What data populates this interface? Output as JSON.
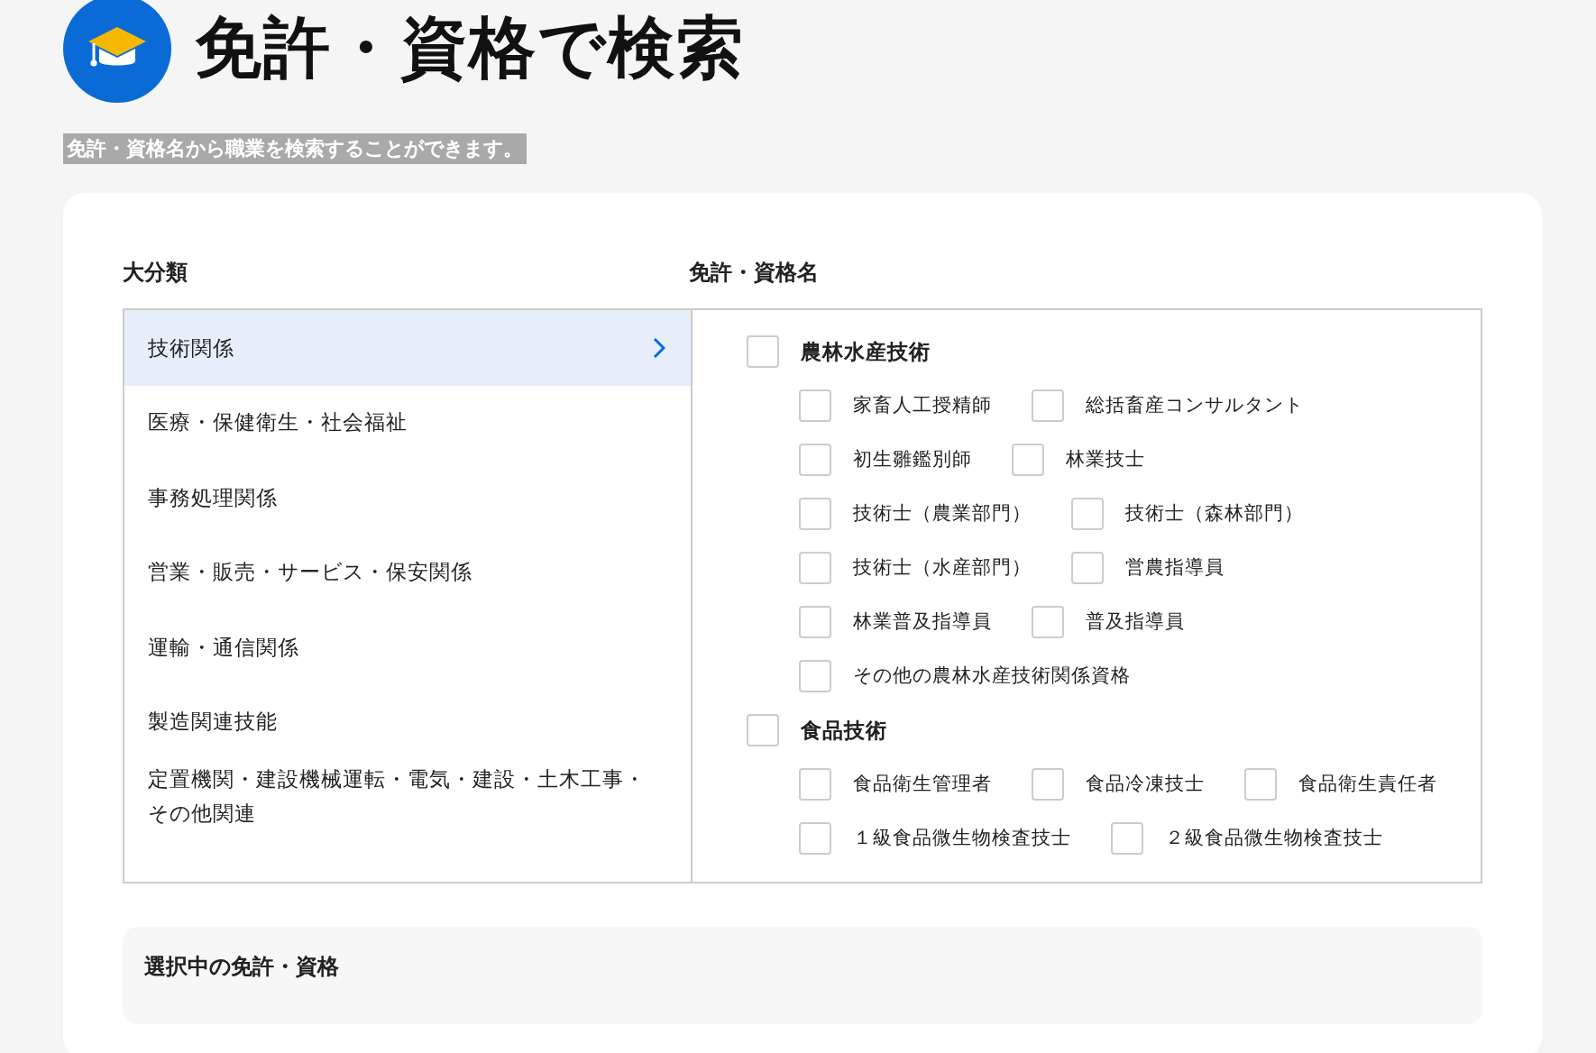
{
  "page": {
    "title": "免許・資格で検索",
    "description": "免許・資格名から職業を検索することができます。"
  },
  "search": {
    "category_heading": "大分類",
    "license_heading": "免許・資格名",
    "categories": [
      {
        "label": "技術関係",
        "selected": true
      },
      {
        "label": "医療・保健衛生・社会福祉",
        "selected": false
      },
      {
        "label": "事務処理関係",
        "selected": false
      },
      {
        "label": "営業・販売・サービス・保安関係",
        "selected": false
      },
      {
        "label": "運輸・通信関係",
        "selected": false
      },
      {
        "label": "製造関連技能",
        "selected": false
      },
      {
        "label": "定置機関・建設機械運転・電気・建設・土木工事・その他関連",
        "selected": false
      }
    ],
    "groups": [
      {
        "label": "農林水産技術",
        "checked": false,
        "rows": [
          [
            {
              "label": "家畜人工授精師",
              "checked": false
            },
            {
              "label": "総括畜産コンサルタント",
              "checked": false
            }
          ],
          [
            {
              "label": "初生雛鑑別師",
              "checked": false
            },
            {
              "label": "林業技士",
              "checked": false
            }
          ],
          [
            {
              "label": "技術士（農業部門）",
              "checked": false
            },
            {
              "label": "技術士（森林部門）",
              "checked": false
            }
          ],
          [
            {
              "label": "技術士（水産部門）",
              "checked": false
            },
            {
              "label": "営農指導員",
              "checked": false
            }
          ],
          [
            {
              "label": "林業普及指導員",
              "checked": false
            },
            {
              "label": "普及指導員",
              "checked": false
            }
          ],
          [
            {
              "label": "その他の農林水産技術関係資格",
              "checked": false
            }
          ]
        ]
      },
      {
        "label": "食品技術",
        "checked": false,
        "rows": [
          [
            {
              "label": "食品衛生管理者",
              "checked": false
            },
            {
              "label": "食品冷凍技士",
              "checked": false
            },
            {
              "label": "食品衛生責任者",
              "checked": false
            }
          ],
          [
            {
              "label": "１級食品微生物検査技士",
              "checked": false
            },
            {
              "label": "２級食品微生物検査技士",
              "checked": false
            }
          ]
        ]
      }
    ]
  },
  "selected_panel": {
    "heading": "選択中の免許・資格"
  }
}
